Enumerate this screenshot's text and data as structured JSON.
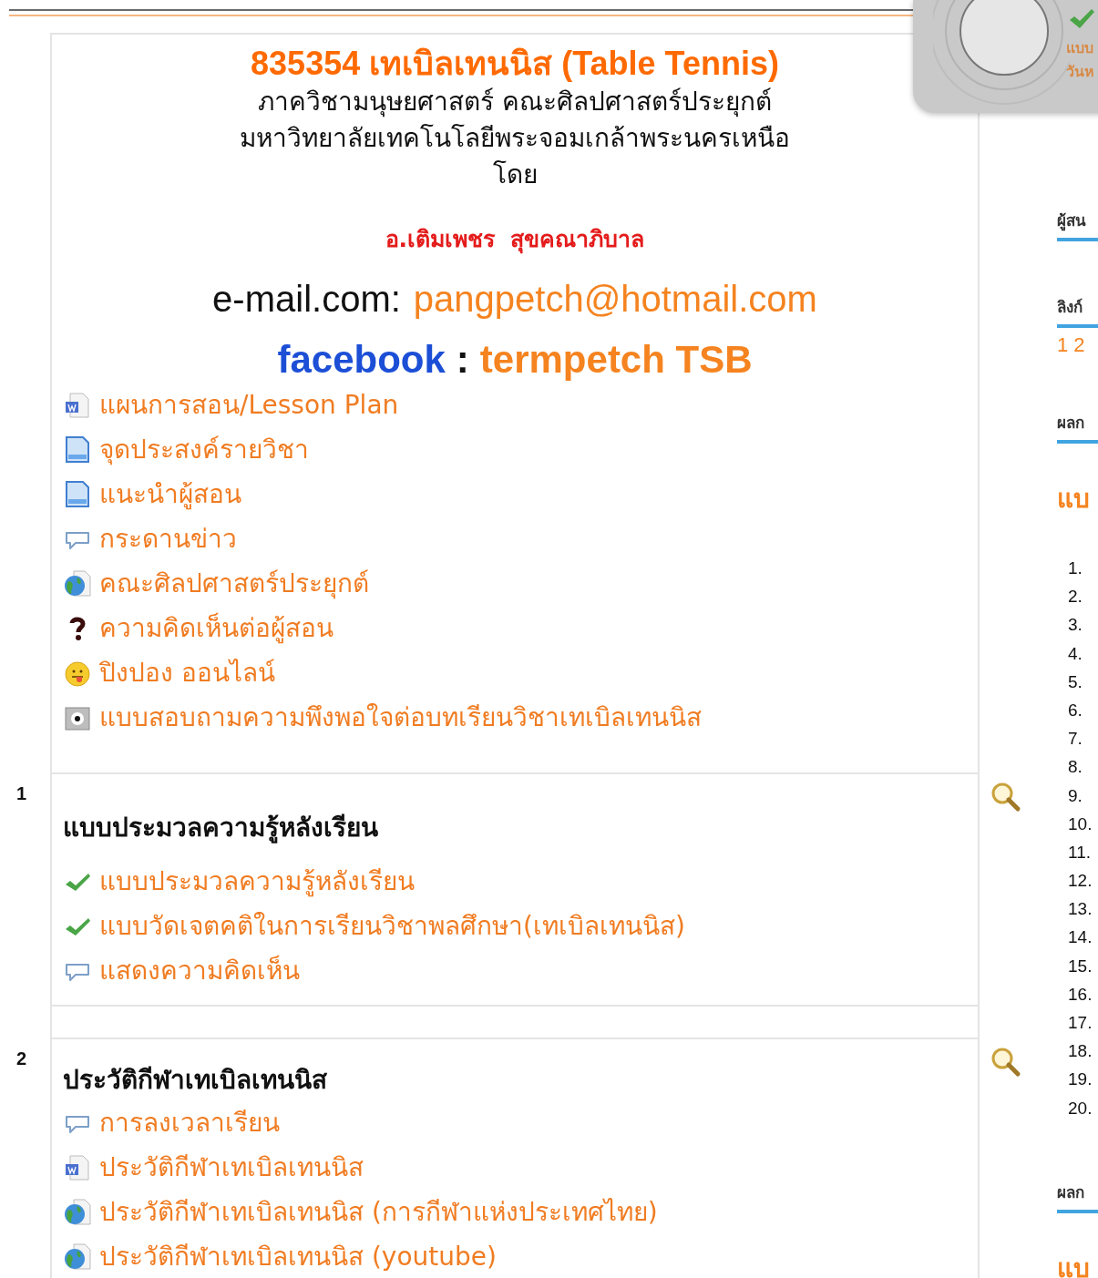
{
  "header": {
    "course_code": "835354",
    "course_title": "เทเบิลเทนนิส (Table Tennis)",
    "department": "ภาควิชามนุษยศาสตร์ คณะศิลปศาสตร์ประยุกต์",
    "university": "มหาวิทยาลัยเทคโนโลยีพระจอมเกล้าพระนครเหนือ",
    "by": "โดย",
    "instructor": "อ.เติมเพชร  สุขคณาภิบาล",
    "email_label": "e-mail.com:",
    "email": "pangpetch@hotmail.com",
    "facebook_label": "facebook",
    "facebook_sep": ":",
    "facebook_name": "termpetch TSB"
  },
  "intro_links": [
    {
      "kind": "word",
      "label": "แผนการสอน/Lesson Plan"
    },
    {
      "kind": "page",
      "label": "จุดประสงค์รายวิชา"
    },
    {
      "kind": "page",
      "label": "แนะนำผู้สอน"
    },
    {
      "kind": "forum",
      "label": "กระดานข่าว"
    },
    {
      "kind": "web",
      "label": "คณะศิลปศาสตร์ประยุกต์"
    },
    {
      "kind": "question",
      "label": "ความคิดเห็นต่อผู้สอน"
    },
    {
      "kind": "chat",
      "label": "ปิงปอง ออนไลน์"
    },
    {
      "kind": "survey",
      "label": "แบบสอบถามความพึงพอใจต่อบทเรียนวิชาเทเบิลเทนนิส"
    }
  ],
  "sections": [
    {
      "number": "1",
      "title": "แบบประมวลความรู้หลังเรียน",
      "links": [
        {
          "kind": "check",
          "label": "แบบประมวลความรู้หลังเรียน"
        },
        {
          "kind": "check",
          "label": "แบบวัดเจตคติในการเรียนวิชาพลศึกษา(เทเบิลเทนนิส)"
        },
        {
          "kind": "forum",
          "label": "แสดงความคิดเห็น"
        }
      ]
    },
    {
      "number": "2",
      "title": "ประวัติกีฬาเทเบิลเทนนิส",
      "links": [
        {
          "kind": "forum",
          "label": "การลงเวลาเรียน"
        },
        {
          "kind": "word",
          "label": "ประวัติกีฬาเทเบิลเทนนิส"
        },
        {
          "kind": "web",
          "label": "ประวัติกีฬาเทเบิลเทนนิส (การกีฬาแห่งประเทศไทย)"
        },
        {
          "kind": "web",
          "label": "ประวัติกีฬาเทเบิลเทนนิส (youtube)"
        }
      ]
    }
  ],
  "right_column": [
    {
      "kind": "heading",
      "text": "ผู้สน"
    },
    {
      "kind": "heading",
      "text": "ลิงก์"
    },
    {
      "kind": "link",
      "text": "1 2"
    },
    {
      "kind": "heading",
      "text": "ผลก"
    },
    {
      "kind": "title",
      "text": "แบ"
    },
    {
      "kind": "number",
      "text": "1."
    },
    {
      "kind": "number",
      "text": "2."
    },
    {
      "kind": "number",
      "text": "3."
    },
    {
      "kind": "number",
      "text": "4."
    },
    {
      "kind": "number",
      "text": "5."
    },
    {
      "kind": "number",
      "text": "6."
    },
    {
      "kind": "number",
      "text": "7."
    },
    {
      "kind": "number",
      "text": "8."
    },
    {
      "kind": "number",
      "text": "9."
    },
    {
      "kind": "number",
      "text": "10."
    },
    {
      "kind": "number",
      "text": "11."
    },
    {
      "kind": "number",
      "text": "12."
    },
    {
      "kind": "number",
      "text": "13."
    },
    {
      "kind": "number",
      "text": "14."
    },
    {
      "kind": "number",
      "text": "15."
    },
    {
      "kind": "number",
      "text": "16."
    },
    {
      "kind": "number",
      "text": "17."
    },
    {
      "kind": "number",
      "text": "18."
    },
    {
      "kind": "number",
      "text": "19."
    },
    {
      "kind": "number",
      "text": "20."
    },
    {
      "kind": "heading",
      "text": "ผลก"
    },
    {
      "kind": "title",
      "text": "แบ"
    }
  ],
  "overlay": {
    "lines": [
      "แบบ",
      "วันห"
    ]
  }
}
